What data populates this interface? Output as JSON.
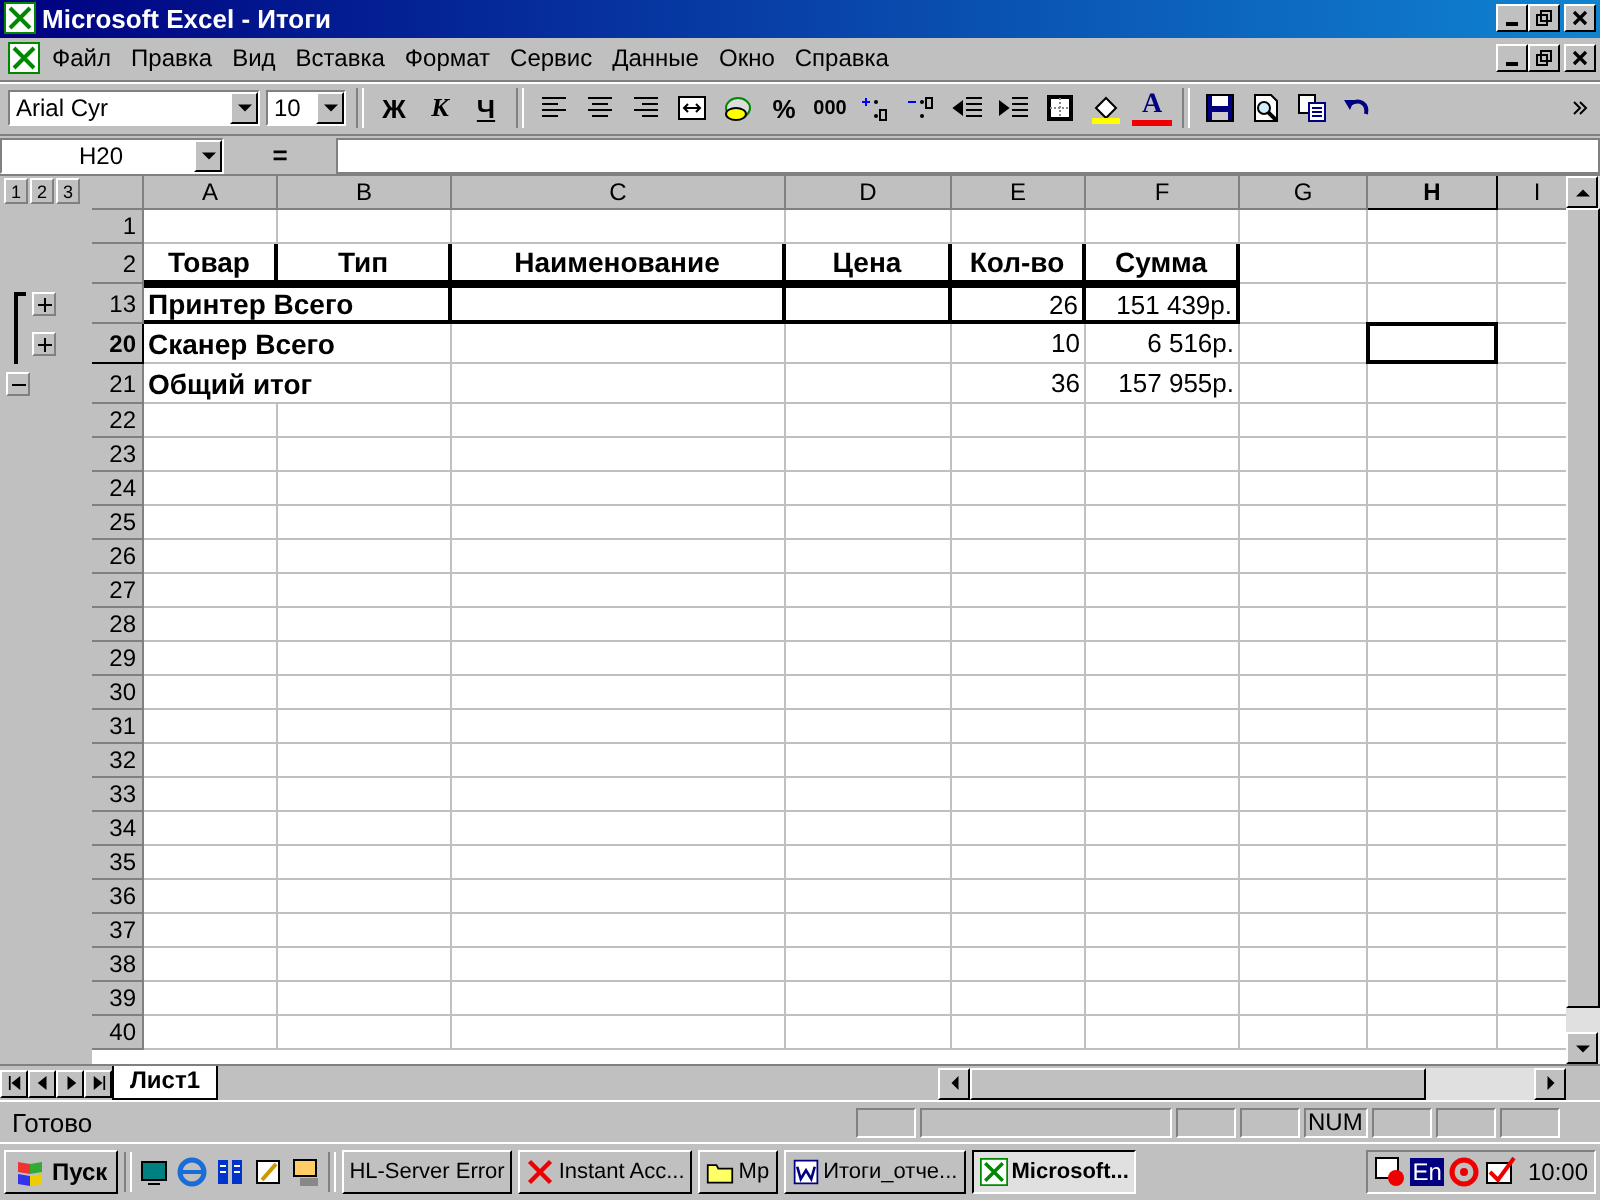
{
  "window": {
    "title": "Microsoft Excel - Итоги"
  },
  "menu": [
    {
      "label": "Файл"
    },
    {
      "label": "Правка"
    },
    {
      "label": "Вид"
    },
    {
      "label": "Вставка"
    },
    {
      "label": "Формат"
    },
    {
      "label": "Сервис"
    },
    {
      "label": "Данные"
    },
    {
      "label": "Окно"
    },
    {
      "label": "Справка"
    }
  ],
  "toolbar": {
    "font": "Arial Cyr",
    "size": "10",
    "bold": "Ж",
    "italic": "К",
    "underline": "Ч",
    "percent": "%",
    "thousands": "000",
    "font_color_letter": "A"
  },
  "formula_bar": {
    "name_box": "H20",
    "equals": "="
  },
  "outline_levels": [
    "1",
    "2",
    "3"
  ],
  "columns": [
    {
      "label": "A",
      "selected": false
    },
    {
      "label": "B",
      "selected": false
    },
    {
      "label": "C",
      "selected": false
    },
    {
      "label": "D",
      "selected": false
    },
    {
      "label": "E",
      "selected": false
    },
    {
      "label": "F",
      "selected": false
    },
    {
      "label": "G",
      "selected": false
    },
    {
      "label": "H",
      "selected": true
    },
    {
      "label": "I",
      "selected": false
    }
  ],
  "rows": [
    {
      "number": "1",
      "selected": false,
      "kind": "plain",
      "cells": {}
    },
    {
      "number": "2",
      "selected": false,
      "kind": "header",
      "cells": [
        "Товар",
        "Тип",
        "Наименование",
        "Цена",
        "Кол-во",
        "Сумма"
      ]
    },
    {
      "number": "13",
      "selected": false,
      "outline": {
        "kind": "expand"
      },
      "kind": "boxed",
      "label": "Принтер Всего",
      "quantity": "26",
      "sum": "151 439р."
    },
    {
      "number": "20",
      "selected": true,
      "outline": {
        "kind": "expand"
      },
      "kind": "plain",
      "label": "Сканер Всего",
      "quantity": "10",
      "sum": "6 516р."
    },
    {
      "number": "21",
      "selected": false,
      "outline": {
        "kind": "collapse"
      },
      "kind": "plain",
      "label": "Общий итог",
      "quantity": "36",
      "sum": "157 955р."
    },
    {
      "number": "22",
      "selected": false,
      "kind": "plain",
      "cells": {}
    },
    {
      "number": "23",
      "selected": false,
      "kind": "plain",
      "cells": {}
    },
    {
      "number": "24",
      "selected": false,
      "kind": "plain",
      "cells": {}
    },
    {
      "number": "25",
      "selected": false,
      "kind": "plain",
      "cells": {}
    },
    {
      "number": "26",
      "selected": false,
      "kind": "plain",
      "cells": {}
    },
    {
      "number": "27",
      "selected": false,
      "kind": "plain",
      "cells": {}
    },
    {
      "number": "28",
      "selected": false,
      "kind": "plain",
      "cells": {}
    },
    {
      "number": "29",
      "selected": false,
      "kind": "plain",
      "cells": {}
    },
    {
      "number": "30",
      "selected": false,
      "kind": "plain",
      "cells": {}
    },
    {
      "number": "31",
      "selected": false,
      "kind": "plain",
      "cells": {}
    },
    {
      "number": "32",
      "selected": false,
      "kind": "plain",
      "cells": {}
    },
    {
      "number": "33",
      "selected": false,
      "kind": "plain",
      "cells": {}
    },
    {
      "number": "34",
      "selected": false,
      "kind": "plain",
      "cells": {}
    },
    {
      "number": "35",
      "selected": false,
      "kind": "plain",
      "cells": {}
    },
    {
      "number": "36",
      "selected": false,
      "kind": "plain",
      "cells": {}
    },
    {
      "number": "37",
      "selected": false,
      "kind": "plain",
      "cells": {}
    },
    {
      "number": "38",
      "selected": false,
      "kind": "plain",
      "cells": {}
    },
    {
      "number": "39",
      "selected": false,
      "kind": "plain",
      "cells": {}
    },
    {
      "number": "40",
      "selected": false,
      "kind": "plain",
      "cells": {}
    }
  ],
  "sheet_tabs": [
    {
      "label": "Лист1",
      "selected": true
    }
  ],
  "status_bar": {
    "text": "Готово",
    "indicator": "NUM"
  },
  "taskbar": {
    "start": "Пуск",
    "tasks": [
      {
        "label": "HL-Server Error",
        "selected": false
      },
      {
        "label": "Instant Acc...",
        "selected": false
      },
      {
        "label": "Mp",
        "selected": false
      },
      {
        "label": "Итоги_отче...",
        "selected": false
      },
      {
        "label": "Microsoft...",
        "selected": true
      }
    ],
    "language": "En",
    "clock": "10:00"
  }
}
